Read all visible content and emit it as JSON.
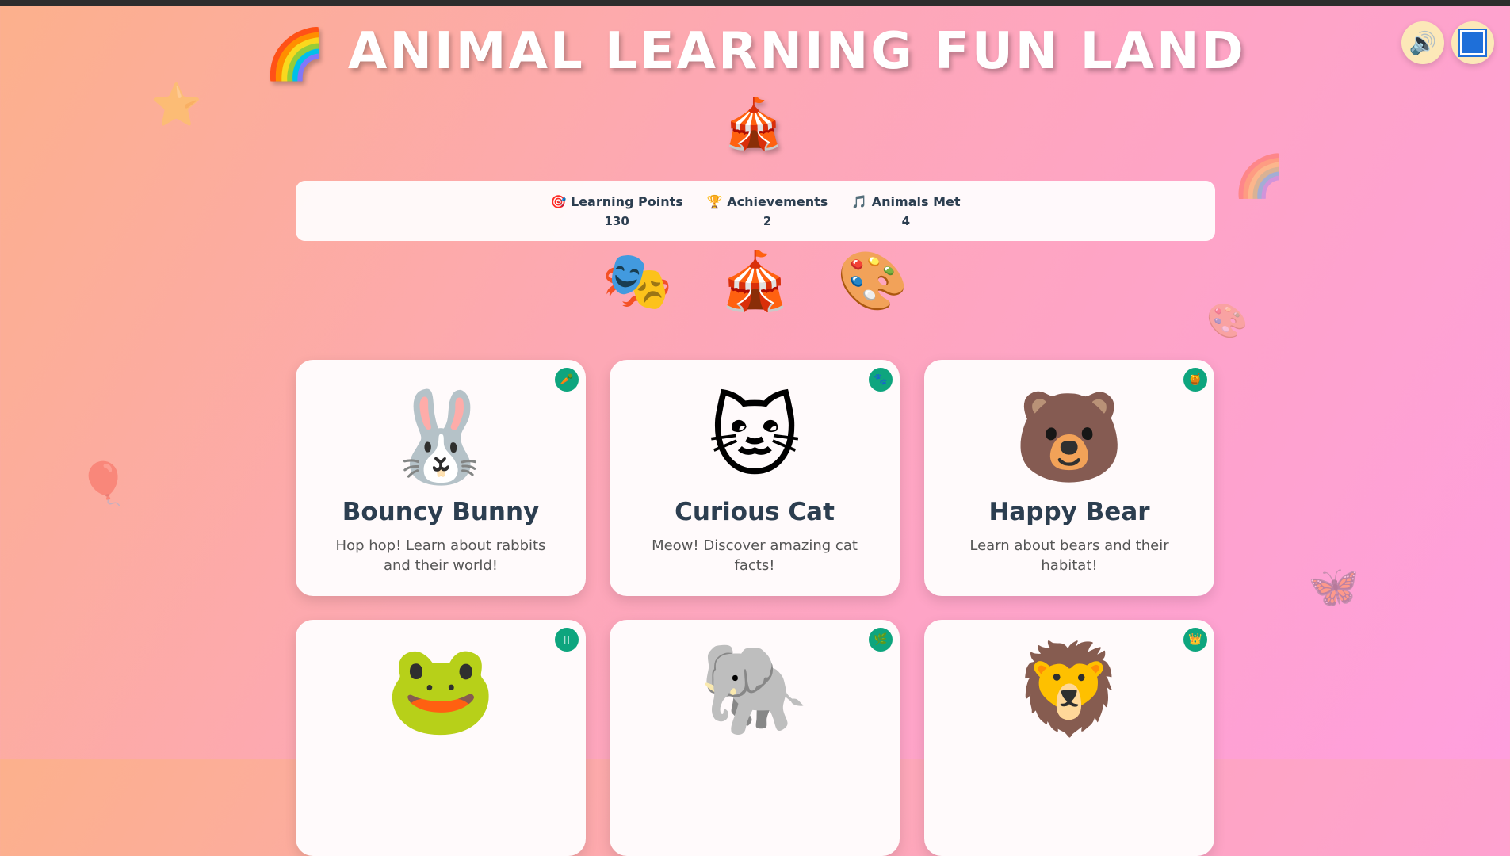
{
  "header": {
    "title_emoji_left": "🌈",
    "title_text": "ANIMAL LEARNING FUN LAND",
    "title_emoji_right": "🎪"
  },
  "controls": {
    "sound_icon": "🔊"
  },
  "stats": [
    {
      "icon": "🎯",
      "label": "Learning Points",
      "value": "130"
    },
    {
      "icon": "🏆",
      "label": "Achievements",
      "value": "2"
    },
    {
      "icon": "🎵",
      "label": "Animals Met",
      "value": "4"
    }
  ],
  "decorations": [
    "🎭",
    "🎪",
    "🎨"
  ],
  "background_decorations": [
    "⭐",
    "🎈",
    "🌈",
    "🎨",
    "🦋"
  ],
  "cards": [
    {
      "emoji": "🐰",
      "badge": "🥕",
      "name": "Bouncy Bunny",
      "description": "Hop hop! Learn about rabbits and their world!"
    },
    {
      "emoji": "🐱",
      "badge": "🐾",
      "name": "Curious Cat",
      "description": "Meow! Discover amazing cat facts!"
    },
    {
      "emoji": "🐻",
      "badge": "🍯",
      "name": "Happy Bear",
      "description": "Learn about bears and their habitat!"
    },
    {
      "emoji": "🐸",
      "badge": "▯",
      "name": "",
      "description": ""
    },
    {
      "emoji": "🐘",
      "badge": "🌿",
      "name": "",
      "description": ""
    },
    {
      "emoji": "🦁",
      "badge": "👑",
      "name": "",
      "description": ""
    }
  ],
  "colors": {
    "badge": "#0ea57e",
    "corner_button": "#fce8b8",
    "stop_icon": "#1e6fd9"
  }
}
